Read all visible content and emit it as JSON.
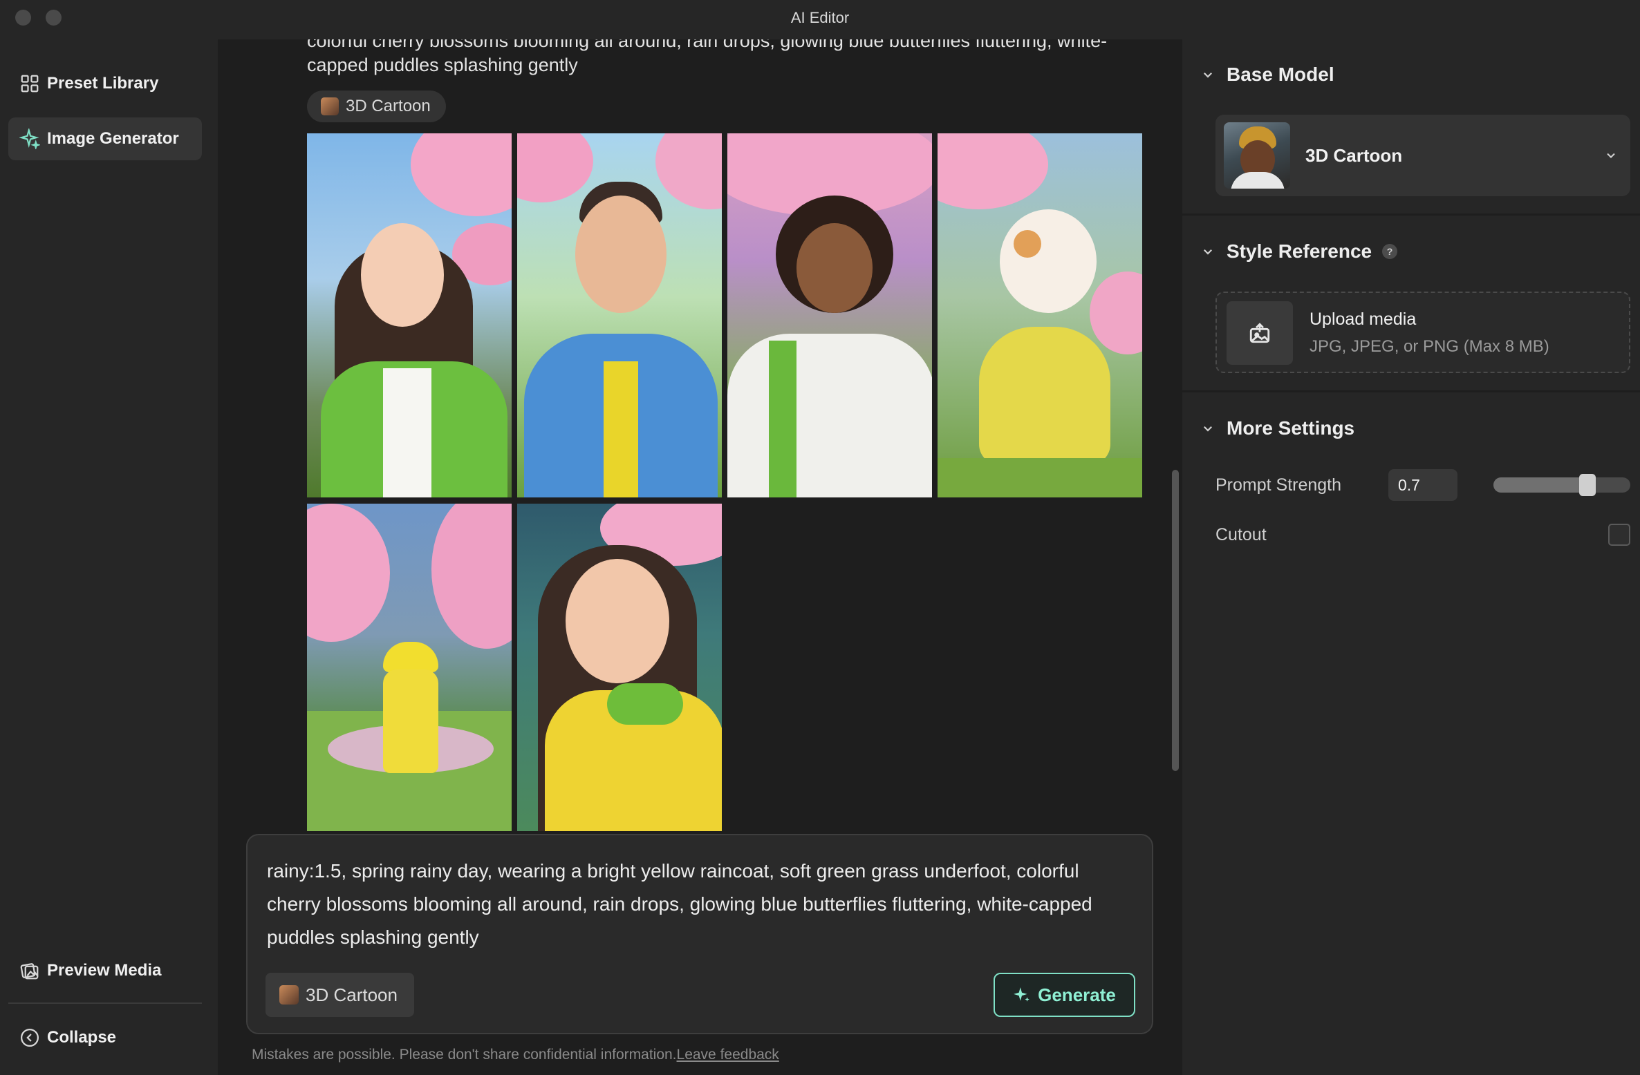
{
  "window": {
    "title": "AI Editor"
  },
  "sidebar": {
    "items": [
      {
        "label": "Preset Library",
        "icon": "grid-icon"
      },
      {
        "label": "Image Generator",
        "icon": "sparkle-icon",
        "active": true
      }
    ],
    "bottom_items": [
      {
        "label": "Preview Media",
        "icon": "preview-media-icon"
      },
      {
        "label": "Collapse",
        "icon": "collapse-icon"
      }
    ]
  },
  "history": {
    "prompt_tail": "colorful cherry blossoms blooming all around, rain drops, glowing blue butterflies fluttering, white-capped puddles splashing gently",
    "style_chip": "3D Cartoon",
    "images": [
      {
        "subject": "long-haired woman in green jacket"
      },
      {
        "subject": "bearded man in blue hoodie"
      },
      {
        "subject": "curly-haired woman in white coat"
      },
      {
        "subject": "white and ginger cat in yellow raincoat"
      },
      {
        "subject": "child in yellow raincoat on path"
      },
      {
        "subject": "woman in yellow raincoat with green hood"
      }
    ]
  },
  "composer": {
    "prompt": "rainy:1.5, spring rainy day, wearing a bright yellow raincoat, soft green grass underfoot, colorful cherry blossoms blooming all around, rain drops, glowing blue butterflies fluttering, white-capped puddles splashing gently",
    "style_chip": "3D Cartoon",
    "generate_label": "Generate"
  },
  "footer": {
    "disclaimer": "Mistakes are possible. Please don't share confidential information.",
    "feedback_link": "Leave feedback"
  },
  "panel": {
    "base_model": {
      "heading": "Base Model",
      "selected": "3D Cartoon"
    },
    "style_reference": {
      "heading": "Style Reference",
      "upload_title": "Upload media",
      "upload_hint": "JPG, JPEG, or PNG (Max 8 MB)"
    },
    "more_settings": {
      "heading": "More Settings",
      "prompt_strength_label": "Prompt Strength",
      "prompt_strength_value": "0.7",
      "prompt_strength_fraction": 0.7,
      "cutout_label": "Cutout",
      "cutout_checked": false
    }
  },
  "colors": {
    "accent": "#8ff0d4",
    "background": "#1e1e1e",
    "panel": "#262626"
  }
}
